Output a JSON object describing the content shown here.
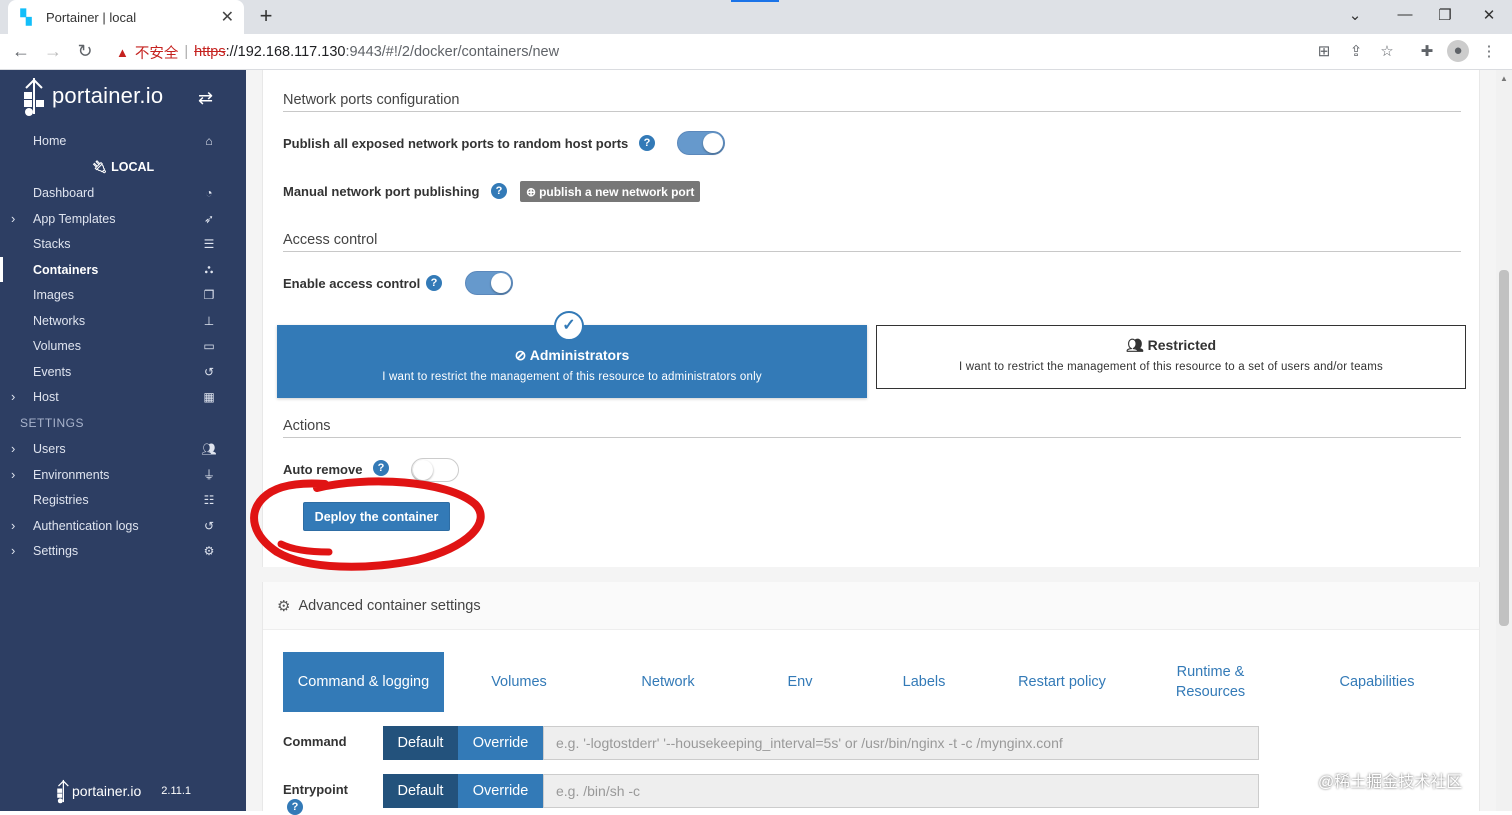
{
  "browser": {
    "tab_title": "Portainer | local",
    "tab_close": "✕",
    "new_tab": "+",
    "insecure_label": "不安全",
    "url_scheme": "https",
    "url_host": "://192.168.117.130",
    "url_rest": ":9443/#!/2/docker/containers/new"
  },
  "sidebar": {
    "brand": "portainer.io",
    "home": "Home",
    "env_name": "LOCAL",
    "items": [
      {
        "label": "Dashboard",
        "icon": "dashboard-icon"
      },
      {
        "label": "App Templates",
        "icon": "rocket-icon"
      },
      {
        "label": "Stacks",
        "icon": "list-icon"
      },
      {
        "label": "Containers",
        "icon": "cubes-icon"
      },
      {
        "label": "Images",
        "icon": "clone-icon"
      },
      {
        "label": "Networks",
        "icon": "sitemap-icon"
      },
      {
        "label": "Volumes",
        "icon": "hdd-icon"
      },
      {
        "label": "Events",
        "icon": "history-icon"
      },
      {
        "label": "Host",
        "icon": "th-icon"
      }
    ],
    "settings_header": "SETTINGS",
    "settings_items": [
      {
        "label": "Users",
        "icon": "users-icon"
      },
      {
        "label": "Environments",
        "icon": "plug-icon"
      },
      {
        "label": "Registries",
        "icon": "database-icon"
      },
      {
        "label": "Authentication logs",
        "icon": "history-icon"
      },
      {
        "label": "Settings",
        "icon": "cogs-icon"
      }
    ],
    "footer_brand": "portainer.io",
    "version": "2.11.1"
  },
  "network": {
    "section_title": "Network ports configuration",
    "publish_all_label": "Publish all exposed network ports to random host ports",
    "publish_all_on": true,
    "manual_label": "Manual network port publishing",
    "publish_button": "publish a new network port"
  },
  "access": {
    "section_title": "Access control",
    "enable_label": "Enable access control",
    "enable_on": true,
    "admin_title": "Administrators",
    "admin_desc": "I want to restrict the management of this resource to administrators only",
    "restricted_title": "Restricted",
    "restricted_desc": "I want to restrict the management of this resource to a set of users and/or teams"
  },
  "actions": {
    "section_title": "Actions",
    "auto_remove_label": "Auto remove",
    "auto_remove_on": false,
    "deploy_button": "Deploy the container"
  },
  "advanced": {
    "title": "Advanced container settings",
    "tabs": [
      {
        "label": "Command & logging",
        "active": true
      },
      {
        "label": "Volumes",
        "active": false
      },
      {
        "label": "Network",
        "active": false
      },
      {
        "label": "Env",
        "active": false
      },
      {
        "label": "Labels",
        "active": false
      },
      {
        "label": "Restart policy",
        "active": false
      },
      {
        "label": "Runtime & Resources",
        "active": false
      },
      {
        "label": "Capabilities",
        "active": false
      }
    ],
    "command_label": "Command",
    "entrypoint_label": "Entrypoint",
    "default_label": "Default",
    "override_label": "Override",
    "command_placeholder": "e.g. '-logtostderr' '--housekeeping_interval=5s' or /usr/bin/nginx -t -c /mynginx.conf",
    "entrypoint_placeholder": "e.g. /bin/sh -c"
  },
  "watermark": "@稀土掘金技术社区",
  "colors": {
    "sidebar_bg": "#2d3e63",
    "primary": "#337ab7",
    "annotation_red": "#e01414"
  }
}
